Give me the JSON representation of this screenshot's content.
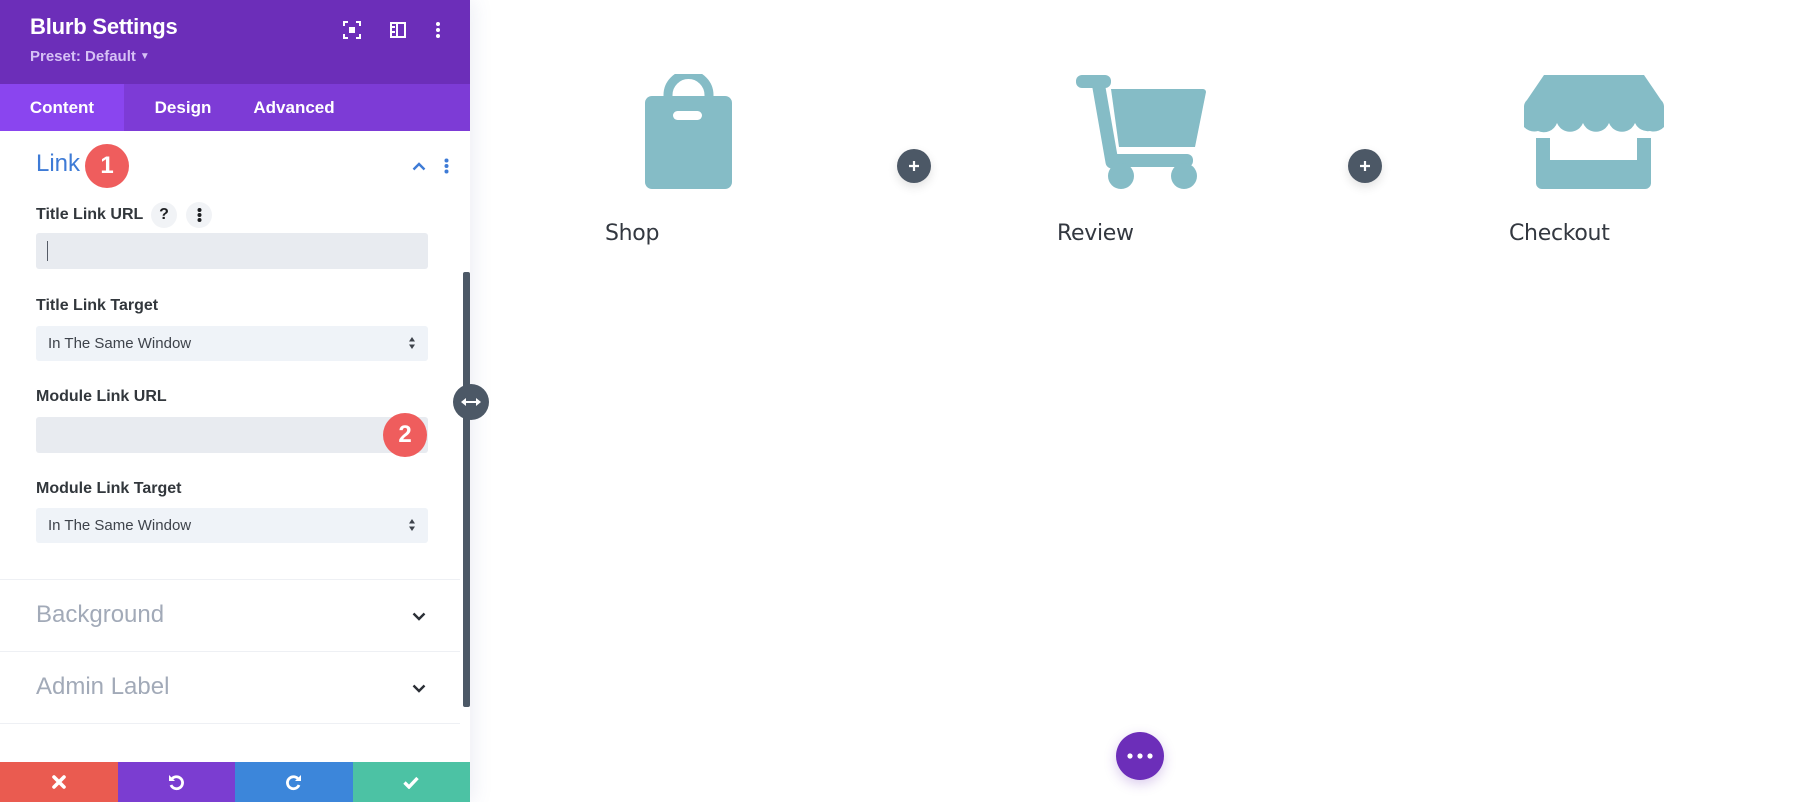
{
  "panel": {
    "title": "Blurb Settings",
    "preset_label": "Preset: Default",
    "header_icons": [
      "focus-mode-icon",
      "split-layout-icon",
      "more-options-icon"
    ],
    "tabs": [
      {
        "label": "Content",
        "active": true
      },
      {
        "label": "Design",
        "active": false
      },
      {
        "label": "Advanced",
        "active": false
      }
    ],
    "link_section": {
      "heading": "Link",
      "expanded": true,
      "badge": "1",
      "fields": {
        "title_link_url": {
          "label": "Title Link URL",
          "value": "",
          "help": "?"
        },
        "title_link_target": {
          "label": "Title Link Target",
          "value": "In The Same Window"
        },
        "module_link_url": {
          "label": "Module Link URL",
          "value": "",
          "badge": "2"
        },
        "module_link_target": {
          "label": "Module Link Target",
          "value": "In The Same Window"
        }
      }
    },
    "collapsed_sections": [
      {
        "label": "Background"
      },
      {
        "label": "Admin Label"
      }
    ],
    "footer": {
      "cancel": {
        "icon": "close-icon",
        "color": "#ea5b50"
      },
      "undo": {
        "icon": "undo-icon",
        "color": "#7b3dd1"
      },
      "redo": {
        "icon": "redo-icon",
        "color": "#3c86da"
      },
      "save": {
        "icon": "check-icon",
        "color": "#4cc2a4"
      }
    }
  },
  "canvas": {
    "icon_color": "#85bcc6",
    "blurbs": [
      {
        "title": "Shop",
        "icon": "shopping-bag-icon"
      },
      {
        "title": "Review",
        "icon": "shopping-cart-icon"
      },
      {
        "title": "Checkout",
        "icon": "storefront-icon"
      }
    ],
    "add_buttons": 2,
    "more_button_icon": "ellipsis-icon"
  },
  "colors": {
    "header_purple": "#6c2eb9",
    "tab_purple": "#7d3bd6",
    "active_tab": "#8a45ef",
    "link_blue": "#3e7bd6",
    "badge_red": "#ef5d5d"
  }
}
